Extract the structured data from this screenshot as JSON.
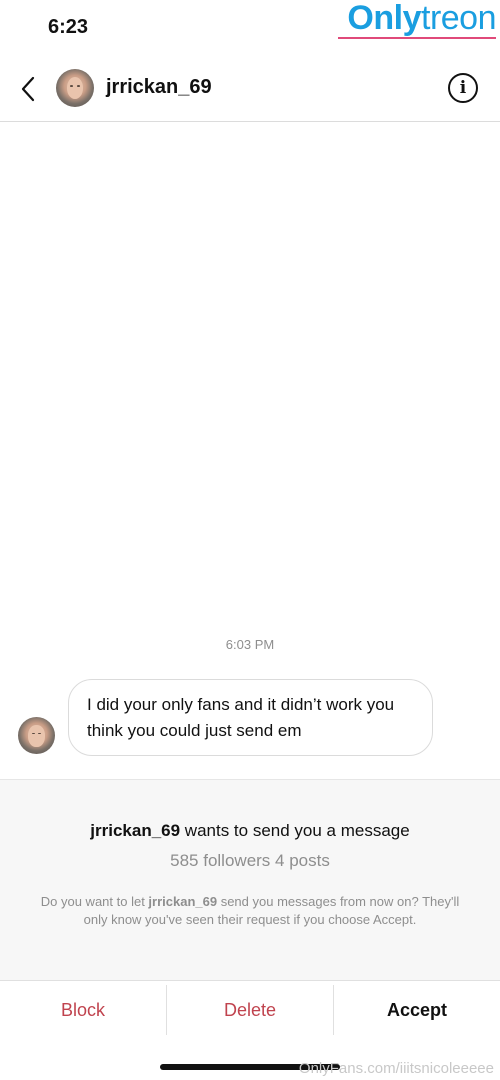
{
  "status_bar": {
    "time": "6:23"
  },
  "watermark": {
    "logo_part_a": "Only",
    "logo_part_b": "treon",
    "footer": "OnlyFans.com/iiitsnicoleeeee"
  },
  "header": {
    "username": "jrrickan_69",
    "back_icon": "chevron-left-icon",
    "info_icon": "info-icon",
    "info_glyph": "i"
  },
  "conversation": {
    "timestamp": "6:03 PM",
    "messages": [
      {
        "text": "I did your only fans and it didn’t work you think you could just send em"
      }
    ]
  },
  "request": {
    "username": "jrrickan_69",
    "title_suffix": " wants to send you a message",
    "stats": "585 followers 4 posts",
    "desc_prefix": "Do you want to let ",
    "desc_username": "jrrickan_69",
    "desc_suffix": " send you messages from now on? They'll only know you've seen their request if you choose Accept."
  },
  "actions": {
    "block": "Block",
    "delete": "Delete",
    "accept": "Accept"
  },
  "colors": {
    "destructive": "#c0434e",
    "muted": "#8e8e8e",
    "logo_blue": "#1a9ee0",
    "logo_underline": "#e04a7a"
  }
}
